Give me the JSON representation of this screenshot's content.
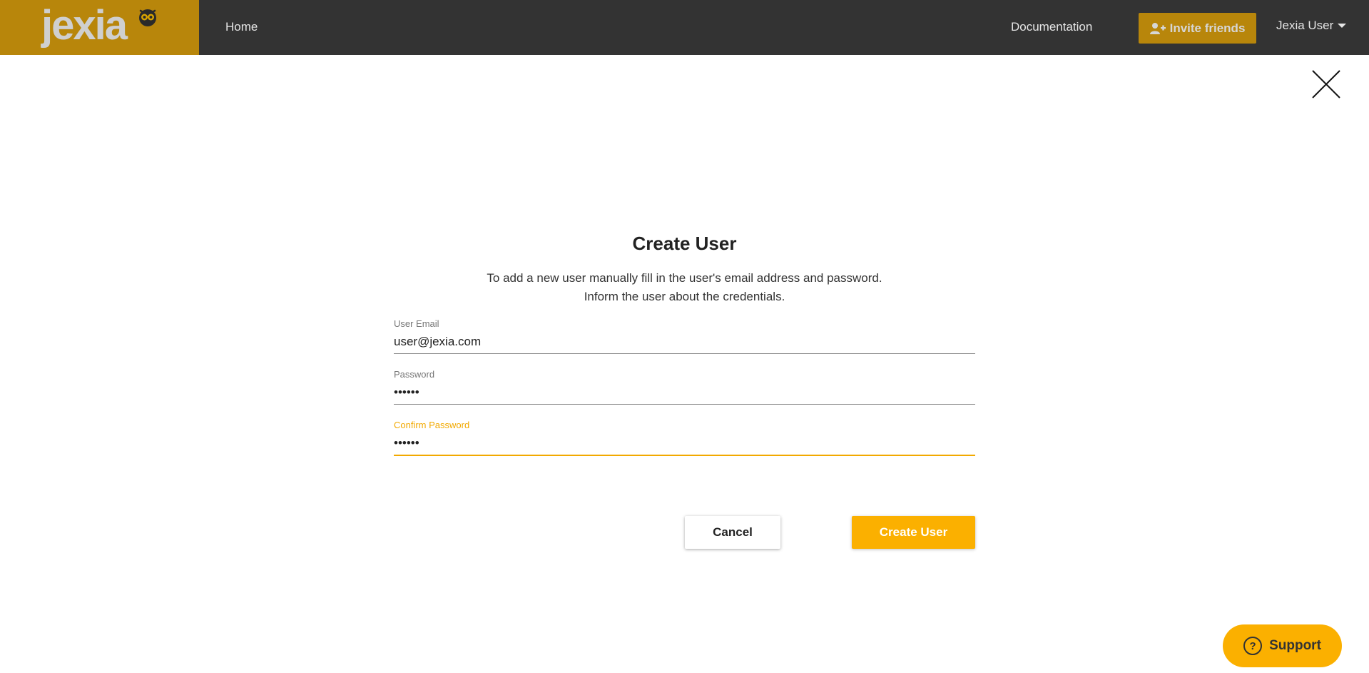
{
  "brand": {
    "logo_text": "jexia",
    "accent_color": "#b8860b",
    "primary_color": "#fbb000"
  },
  "header": {
    "nav": {
      "home": "Home",
      "documentation": "Documentation"
    },
    "invite_label": "Invite friends",
    "invite_icon": "user-plus-icon",
    "user_label": "Jexia User"
  },
  "dialog": {
    "title": "Create User",
    "description_line1": "To add a new user manually fill in the user's email address and password.",
    "description_line2": "Inform the user about the credentials.",
    "fields": {
      "email": {
        "label": "User Email",
        "value": "user@jexia.com"
      },
      "password": {
        "label": "Password",
        "value": "••••••"
      },
      "confirm_password": {
        "label": "Confirm Password",
        "value": "••••••",
        "focused": true
      }
    },
    "cancel_label": "Cancel",
    "submit_label": "Create User"
  },
  "support": {
    "label": "Support",
    "icon": "question-circle-icon"
  }
}
